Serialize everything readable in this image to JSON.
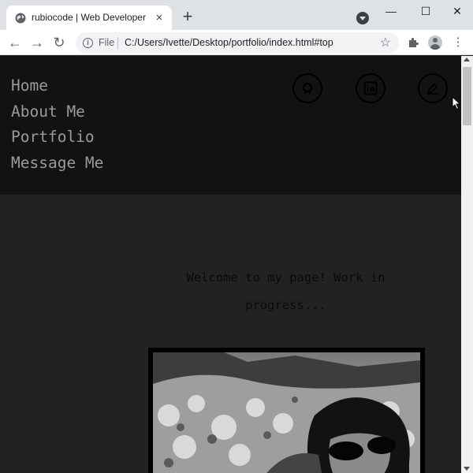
{
  "browser": {
    "tab_title": "rubiocode | Web Developer",
    "new_tab_label": "+",
    "tab_close_label": "×",
    "window_minimize": "—",
    "window_maximize": "☐",
    "window_close": "✕",
    "scheme_label": "File",
    "url": "C:/Users/Ivette/Desktop/portfolio/index.html#top",
    "back_glyph": "←",
    "forward_glyph": "→",
    "reload_glyph": "↻",
    "star_glyph": "☆",
    "menu_glyph": "⋮",
    "info_glyph": "i"
  },
  "site": {
    "nav": [
      "Home",
      "About Me",
      "Portfolio",
      "Message Me"
    ],
    "social_icons": [
      "github-icon",
      "linkedin-icon",
      "edit-icon"
    ],
    "welcome": "Welcome to my page! Work in progress..."
  },
  "colors": {
    "header_bg": "#121213",
    "page_bg": "#222224",
    "nav_text": "#9a9a9a",
    "tab_strip": "#dee1e6"
  }
}
